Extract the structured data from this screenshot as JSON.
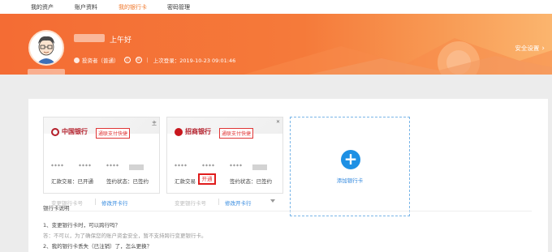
{
  "nav": {
    "tabs": [
      "我的资产",
      "账户资料",
      "我的银行卡",
      "密码管理"
    ],
    "active_index": 2
  },
  "banner": {
    "greeting": "上午好",
    "role": "投资者（普通）",
    "last_login": "上次登录：2019-10-23 09:01:46",
    "safety_link": "安全设置"
  },
  "cards": [
    {
      "bank_name": "中国银行",
      "tag": "通联支付快捷",
      "corner": "主",
      "card_number_masked": [
        "****",
        "****",
        "****"
      ],
      "trade_status": "汇款交易：已开通",
      "sign_status": "签约状态：已签约",
      "change_link": "变更银行卡号",
      "modify_link": "修改开卡行"
    },
    {
      "bank_name": "招商银行",
      "tag": "通联支付快捷",
      "corner": "✕",
      "card_number_masked": [
        "****",
        "****",
        "****"
      ],
      "trade_label": "汇款交易",
      "trade_open": "开通",
      "sign_status": "签约状态：已签约",
      "change_link": "变更银行卡号",
      "modify_link": "修改开卡行"
    }
  ],
  "add_card": {
    "icon": "+",
    "label": "添加银行卡"
  },
  "notes": {
    "title": "银行卡说明",
    "q1": "1、变更银行卡时，可以跨行吗？",
    "a1": "答：不可以，为了确保您的账户资金安全，暂不支持跨行变更银行卡。",
    "q2": "2、我的银行卡丢失（已注销）了，怎么更换？"
  },
  "colors": {
    "accent": "#f0782c",
    "banner": "#f46c34",
    "link": "#2e86de",
    "danger": "#e01c1c"
  }
}
